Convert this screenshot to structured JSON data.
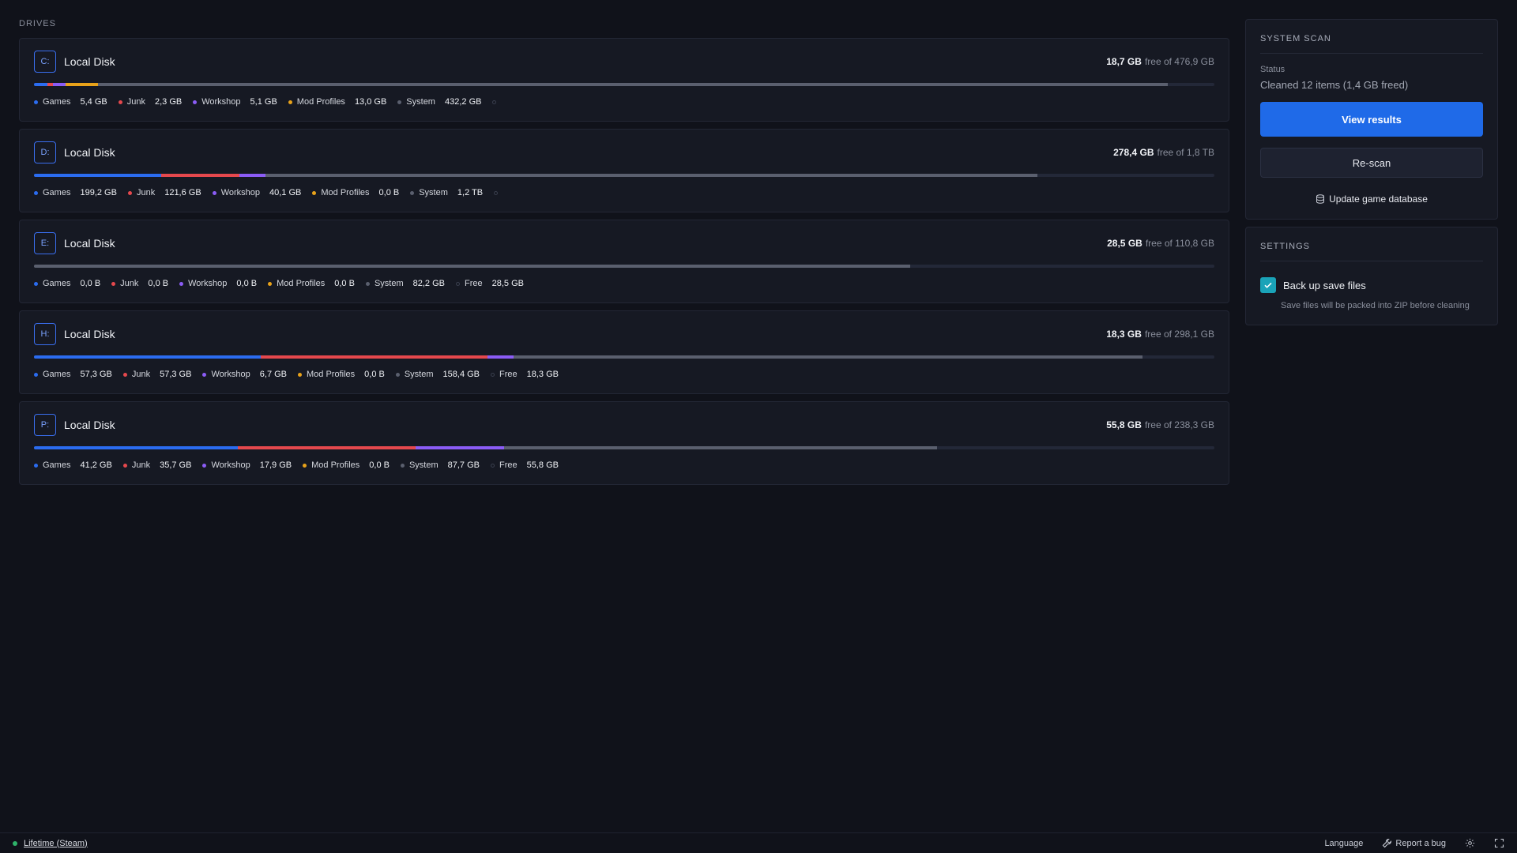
{
  "drives_label": "DRIVES",
  "legend_labels": {
    "games": "Games",
    "junk": "Junk",
    "workshop": "Workshop",
    "mod_profiles": "Mod Profiles",
    "system": "System",
    "free": "Free"
  },
  "colors": {
    "games": "#2b6cf0",
    "junk": "#e5484d",
    "workshop": "#8b5cf6",
    "mod_profiles": "#e8a21a",
    "system": "#5a5f6e",
    "accent": "#1f6ae8",
    "checkbox": "#1aa3b8"
  },
  "drives": [
    {
      "letter": "C:",
      "name": "Local Disk",
      "free_value": "18,7 GB",
      "free_of": "free of 476,9 GB",
      "usage_fraction": {
        "games": 0.0113,
        "junk": 0.0048,
        "workshop": 0.0107,
        "mod_profiles": 0.0273,
        "system": 0.9061
      },
      "legend": {
        "games": "5,4 GB",
        "junk": "2,3 GB",
        "workshop": "5,1 GB",
        "mod_profiles": "13,0 GB",
        "system": "432,2 GB",
        "free": ""
      }
    },
    {
      "letter": "D:",
      "name": "Local Disk",
      "free_value": "278,4 GB",
      "free_of": "free of 1,8 TB",
      "usage_fraction": {
        "games": 0.108,
        "junk": 0.066,
        "workshop": 0.022,
        "mod_profiles": 0.0,
        "system": 0.654
      },
      "legend": {
        "games": "199,2 GB",
        "junk": "121,6 GB",
        "workshop": "40,1 GB",
        "mod_profiles": "0,0 B",
        "system": "1,2 TB",
        "free": ""
      }
    },
    {
      "letter": "E:",
      "name": "Local Disk",
      "free_value": "28,5 GB",
      "free_of": "free of 110,8 GB",
      "usage_fraction": {
        "games": 0.0,
        "junk": 0.0,
        "workshop": 0.0,
        "mod_profiles": 0.0,
        "system": 0.742
      },
      "legend": {
        "games": "0,0 B",
        "junk": "0,0 B",
        "workshop": "0,0 B",
        "mod_profiles": "0,0 B",
        "system": "82,2 GB",
        "free": "28,5 GB"
      }
    },
    {
      "letter": "H:",
      "name": "Local Disk",
      "free_value": "18,3 GB",
      "free_of": "free of 298,1 GB",
      "usage_fraction": {
        "games": 0.192,
        "junk": 0.192,
        "workshop": 0.022,
        "mod_profiles": 0.0,
        "system": 0.533
      },
      "legend": {
        "games": "57,3 GB",
        "junk": "57,3 GB",
        "workshop": "6,7 GB",
        "mod_profiles": "0,0 B",
        "system": "158,4 GB",
        "free": "18,3 GB"
      }
    },
    {
      "letter": "P:",
      "name": "Local Disk",
      "free_value": "55,8 GB",
      "free_of": "free of 238,3 GB",
      "usage_fraction": {
        "games": 0.173,
        "junk": 0.15,
        "workshop": 0.075,
        "mod_profiles": 0.0,
        "system": 0.367
      },
      "legend": {
        "games": "41,2 GB",
        "junk": "35,7 GB",
        "workshop": "17,9 GB",
        "mod_profiles": "0,0 B",
        "system": "87,7 GB",
        "free": "55,8 GB"
      }
    }
  ],
  "system_scan": {
    "title": "SYSTEM SCAN",
    "status_label": "Status",
    "status_text": "Cleaned 12 items (1,4 GB freed)",
    "view_results": "View results",
    "rescan": "Re-scan",
    "update_db": "Update game database"
  },
  "settings": {
    "title": "SETTINGS",
    "backup_label": "Back up save files",
    "backup_checked": true,
    "backup_help": "Save files will be packed into ZIP before cleaning"
  },
  "footer": {
    "account": "Lifetime (Steam)",
    "language": "Language",
    "report_bug": "Report a bug"
  }
}
